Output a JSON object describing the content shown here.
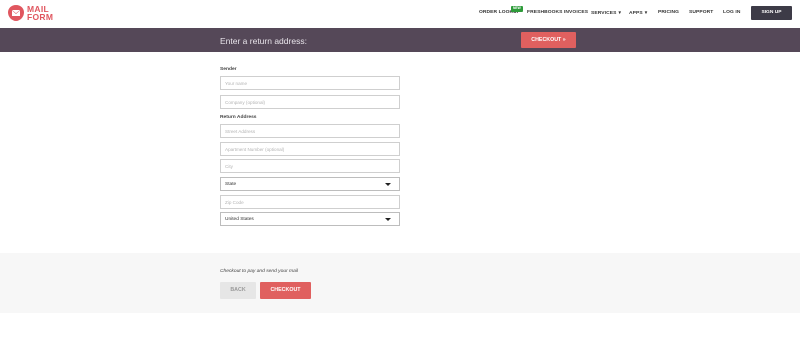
{
  "brand": {
    "name_line1": "MAIL",
    "name_line2": "FORM",
    "color": "#e0565f"
  },
  "nav": {
    "items": [
      {
        "label": "ORDER LOOKUP",
        "badge": "NEW"
      },
      {
        "label": "FRESHBOOKS INVOICES"
      },
      {
        "label": "SERVICES",
        "caret": "▼"
      },
      {
        "label": "APPS",
        "caret": "▼"
      },
      {
        "label": "PRICING"
      },
      {
        "label": "SUPPORT"
      },
      {
        "label": "LOG IN"
      }
    ],
    "signup_label": "SIGN UP"
  },
  "banner": {
    "title": "Enter a return address:",
    "checkout_label": "CHECKOUT »",
    "background": "#554858",
    "accent": "#e0605f"
  },
  "form": {
    "sender_label": "Sender",
    "sender_name": {
      "value": "",
      "placeholder": "Your name"
    },
    "company": {
      "value": "",
      "placeholder": "Company (optional)"
    },
    "return_label": "Return Address",
    "street": {
      "value": "",
      "placeholder": "Street Address"
    },
    "apartment": {
      "value": "",
      "placeholder": "Apartment Number (optional)"
    },
    "city": {
      "value": "",
      "placeholder": "City"
    },
    "state": {
      "selected": "State"
    },
    "zip": {
      "value": "",
      "placeholder": "Zip Code"
    },
    "country": {
      "selected": "United States"
    }
  },
  "checkout_bar": {
    "note": "Checkout to pay and send your mail",
    "back_label": "BACK",
    "checkout_label": "CHECKOUT"
  }
}
